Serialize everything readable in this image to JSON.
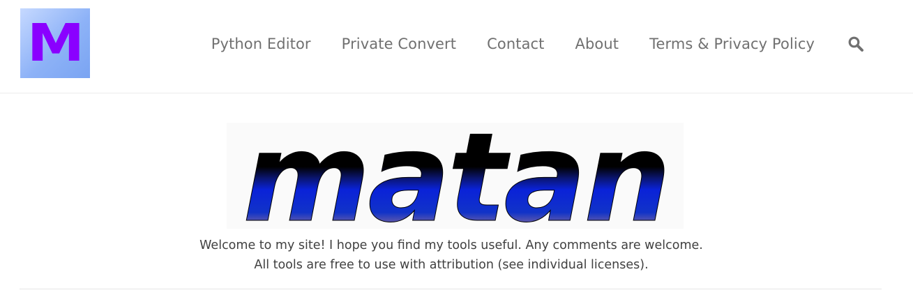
{
  "header": {
    "logo_letter": "M",
    "nav": [
      {
        "label": "Python Editor"
      },
      {
        "label": "Private Convert"
      },
      {
        "label": "Contact"
      },
      {
        "label": "About"
      },
      {
        "label": "Terms & Privacy Policy"
      }
    ],
    "search_icon": "search-icon"
  },
  "hero": {
    "wordmark": "matan"
  },
  "intro": {
    "text": "Welcome to my site! I hope you find my tools useful. Any comments are welcome. All tools are free to use with attribution (see individual licenses)."
  },
  "colors": {
    "logo_letter": "#8a00ff",
    "nav_text": "#707070",
    "body_text": "#404040",
    "wordmark_dark": "#000000",
    "wordmark_blue": "#0a22d8",
    "wordmark_orange": "#f07a2a"
  }
}
